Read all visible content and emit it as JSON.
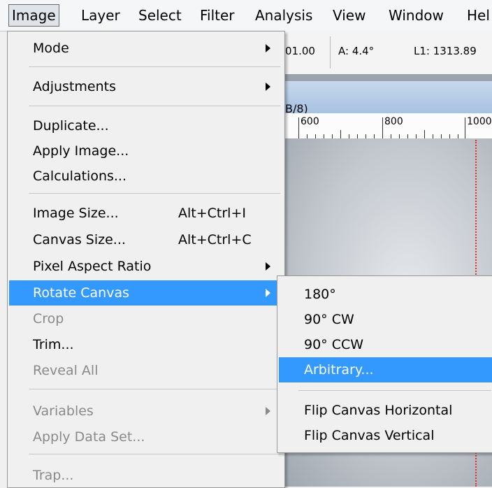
{
  "menubar": {
    "items": [
      "Image",
      "Layer",
      "Select",
      "Filter",
      "Analysis",
      "View",
      "Window",
      "Hel"
    ]
  },
  "options_bar": {
    "value_1": "01.00",
    "angle": "A: 4.4°",
    "length": "L1: 1313.89"
  },
  "document": {
    "title_fragment": "B/8)",
    "ruler_labels": [
      "600",
      "800",
      "1000"
    ]
  },
  "image_menu": {
    "mode": "Mode",
    "adjustments": "Adjustments",
    "duplicate": "Duplicate...",
    "apply_image": "Apply Image...",
    "calculations": "Calculations...",
    "image_size": "Image Size...",
    "image_size_shortcut": "Alt+Ctrl+I",
    "canvas_size": "Canvas Size...",
    "canvas_size_shortcut": "Alt+Ctrl+C",
    "pixel_aspect_ratio": "Pixel Aspect Ratio",
    "rotate_canvas": "Rotate Canvas",
    "crop": "Crop",
    "trim": "Trim...",
    "reveal_all": "Reveal All",
    "variables": "Variables",
    "apply_data_set": "Apply Data Set...",
    "trap": "Trap..."
  },
  "rotate_submenu": {
    "r180": "180°",
    "r90cw": "90° CW",
    "r90ccw": "90° CCW",
    "arbitrary": "Arbitrary...",
    "flip_horizontal": "Flip Canvas Horizontal",
    "flip_vertical": "Flip Canvas Vertical"
  },
  "colors": {
    "highlight": "#3399ff",
    "disabled_text": "#8a8a8a"
  }
}
